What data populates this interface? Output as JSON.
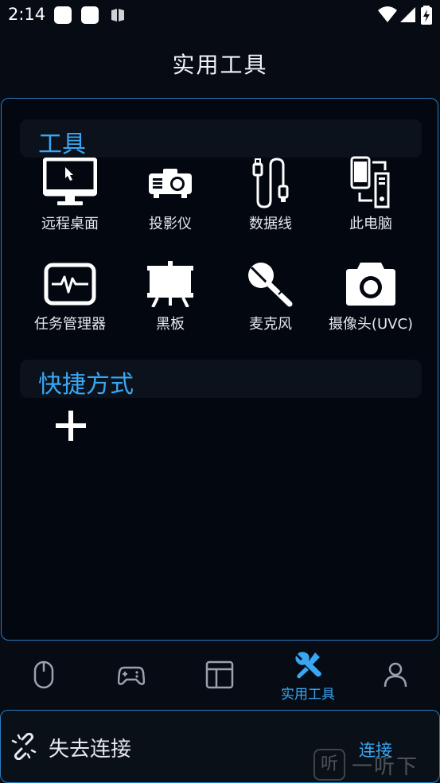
{
  "status_bar": {
    "time": "2:14",
    "icons": [
      "notification-icon",
      "notification-icon",
      "book-icon",
      "wifi-icon",
      "signal-icon",
      "battery-charging-icon"
    ]
  },
  "header": {
    "title": "实用工具"
  },
  "tools_section": {
    "title": "工具",
    "items": [
      {
        "label": "远程桌面",
        "icon": "remote-desktop-icon"
      },
      {
        "label": "投影仪",
        "icon": "projector-icon"
      },
      {
        "label": "数据线",
        "icon": "usb-cable-icon"
      },
      {
        "label": "此电脑",
        "icon": "this-pc-icon"
      },
      {
        "label": "任务管理器",
        "icon": "task-manager-icon"
      },
      {
        "label": "黑板",
        "icon": "blackboard-icon"
      },
      {
        "label": "麦克风",
        "icon": "microphone-icon"
      },
      {
        "label": "摄像头(UVC)",
        "icon": "camera-icon"
      }
    ]
  },
  "shortcuts_section": {
    "title": "快捷方式",
    "add_icon": "plus-icon"
  },
  "tabbar": {
    "items": [
      {
        "icon": "mouse-icon",
        "label": ""
      },
      {
        "icon": "gamepad-icon",
        "label": ""
      },
      {
        "icon": "layout-icon",
        "label": ""
      },
      {
        "icon": "tools-icon",
        "label": "实用工具",
        "active": true
      },
      {
        "icon": "user-icon",
        "label": ""
      }
    ]
  },
  "connection": {
    "status": "失去连接",
    "action": "连接",
    "icon": "broken-link-icon"
  },
  "watermark": {
    "box_char": "听",
    "text": "一听下载"
  },
  "colors": {
    "accent": "#3aa6f2",
    "border": "#2a7cc0",
    "background": "#060b14"
  }
}
